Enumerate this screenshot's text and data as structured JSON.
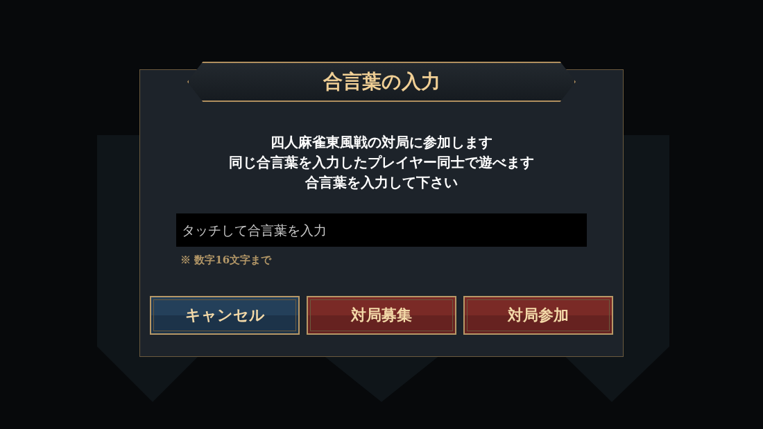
{
  "dialog": {
    "title": "合言葉の入力",
    "message_lines": [
      "四人麻雀東風戦の対局に参加します",
      "同じ合言葉を入力したプレイヤー同士で遊べます",
      "合言葉を入力して下さい"
    ],
    "input": {
      "placeholder": "タッチして合言葉を入力"
    },
    "note": "※ 数字16文字まで",
    "buttons": [
      {
        "label": "キャンセル",
        "kind": "cancel"
      },
      {
        "label": "対局募集",
        "kind": "confirm"
      },
      {
        "label": "対局参加",
        "kind": "confirm"
      }
    ]
  }
}
